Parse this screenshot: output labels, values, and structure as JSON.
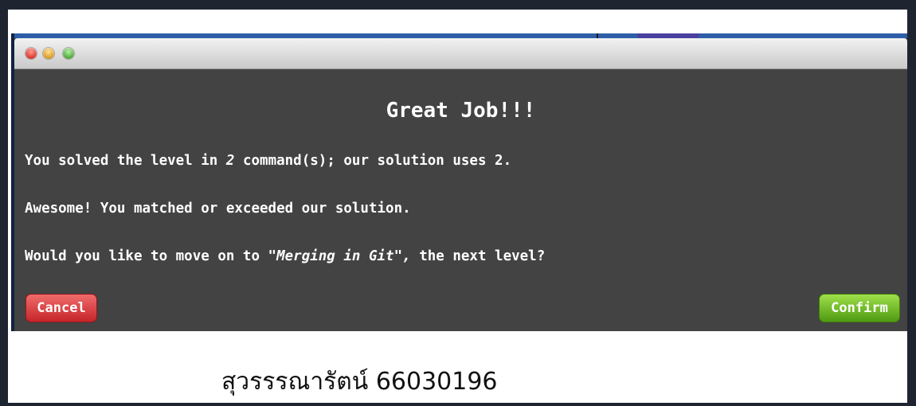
{
  "dialog": {
    "title": "Great Job!!!",
    "solved_prefix": "You solved the level in ",
    "solved_count": "2",
    "solved_suffix": " command(s); our solution uses 2.",
    "praise": "Awesome! You matched or exceeded our solution.",
    "next_prefix": "Would you like to move on to ",
    "next_level": "\"Merging in Git\",",
    "next_suffix": " the next level?",
    "cancel_label": "Cancel",
    "confirm_label": "Confirm"
  },
  "window_controls": {
    "close_color": "#e0443e",
    "minimize_color": "#e6a632",
    "maximize_color": "#59b445"
  },
  "caption": {
    "text": "สุวรรรณารัตน์ 66030196"
  },
  "colors": {
    "dialog_background": "#434343",
    "cancel_button": "#d83a3f",
    "confirm_button": "#6fbd22"
  }
}
